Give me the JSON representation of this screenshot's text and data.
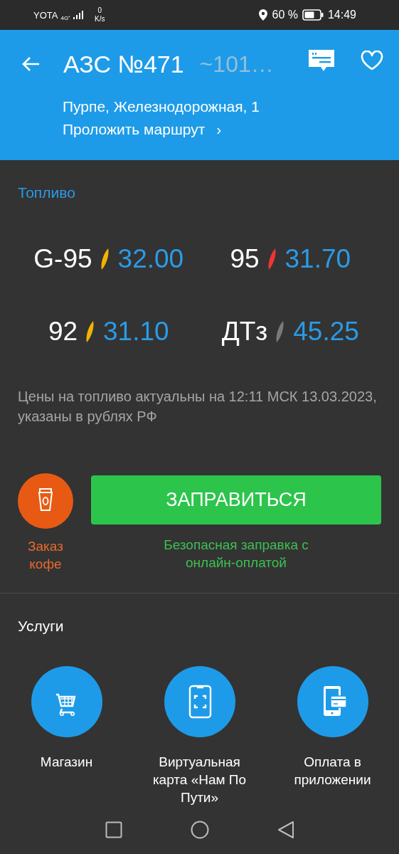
{
  "status_bar": {
    "carrier": "YOTA",
    "network": "4G⁺",
    "speed_value": "0",
    "speed_unit": "K/s",
    "battery": "60 %",
    "time": "14:49"
  },
  "header": {
    "title": "АЗС №471",
    "distance": "~101…",
    "address": "Пурпе, Железнодорожная, 1",
    "route_link": "Проложить маршрут",
    "route_chevron": "›"
  },
  "fuel": {
    "heading": "Топливо",
    "items": [
      {
        "name": "G-95",
        "color": "#f0b400",
        "price": "32.00"
      },
      {
        "name": "95",
        "color": "#f03434",
        "price": "31.70"
      },
      {
        "name": "92",
        "color": "#f0b400",
        "price": "31.10"
      },
      {
        "name": "ДТз",
        "color": "#7a7a7a",
        "price": "45.25"
      }
    ],
    "note": "Цены на топливо актуальны на 12:11 МСК 13.03.2023, указаны в рублях РФ"
  },
  "actions": {
    "coffee_label": "Заказ кофе",
    "refuel_button": "ЗАПРАВИТЬСЯ",
    "refuel_caption": "Безопасная заправка с онлайн-оплатой"
  },
  "services": {
    "heading": "Услуги",
    "items": [
      {
        "kind": "shop",
        "label": "Магазин"
      },
      {
        "kind": "virtual_card",
        "label": "Виртуальная карта «Нам По Пути»"
      },
      {
        "kind": "app_payment",
        "label": "Оплата в приложении"
      }
    ]
  }
}
